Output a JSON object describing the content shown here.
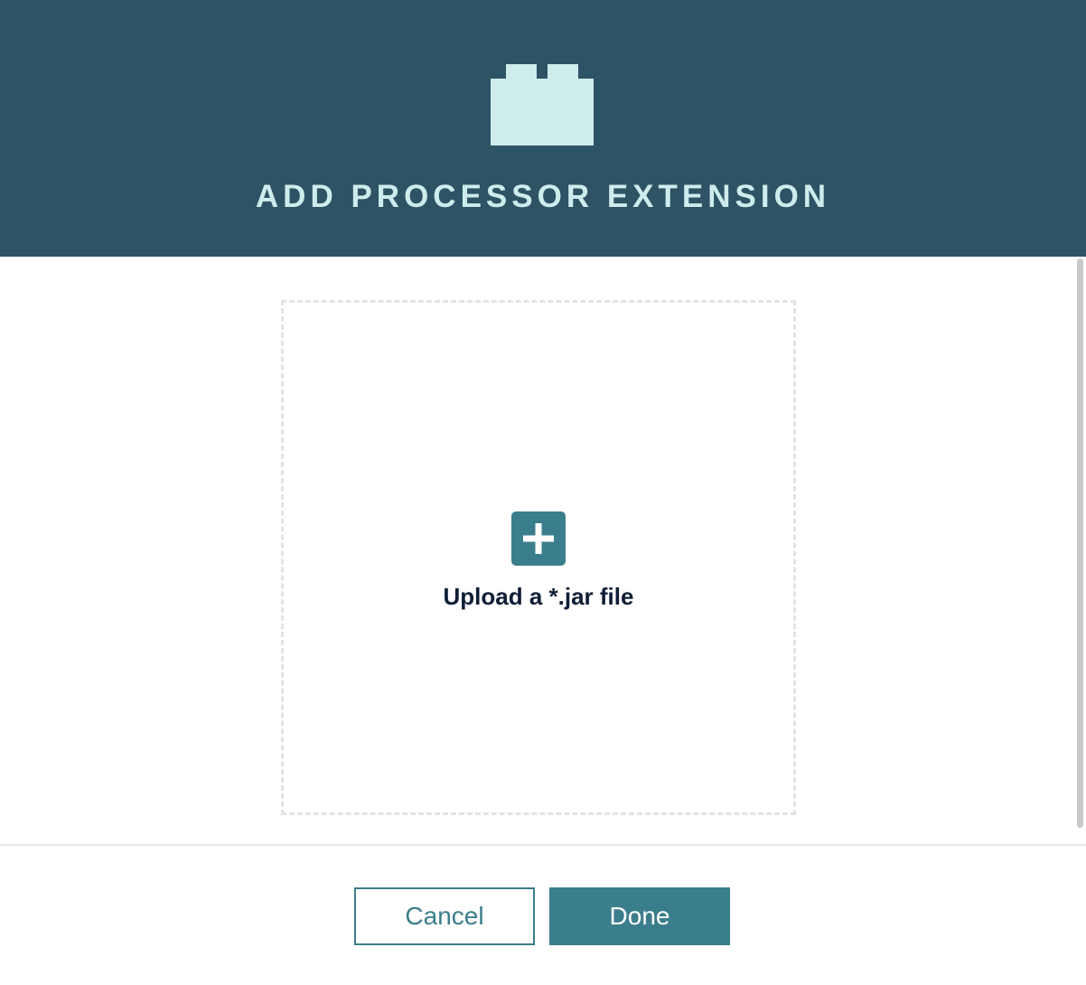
{
  "dialog": {
    "title": "ADD PROCESSOR EXTENSION",
    "header_icon": "brick-icon",
    "colors": {
      "header_bg": "#2d5365",
      "header_fg": "#cfeced",
      "accent": "#3b7e8b",
      "text_dark": "#0f1e36"
    }
  },
  "upload": {
    "icon": "plus-icon",
    "label": "Upload a *.jar file"
  },
  "footer": {
    "cancel_label": "Cancel",
    "done_label": "Done"
  }
}
